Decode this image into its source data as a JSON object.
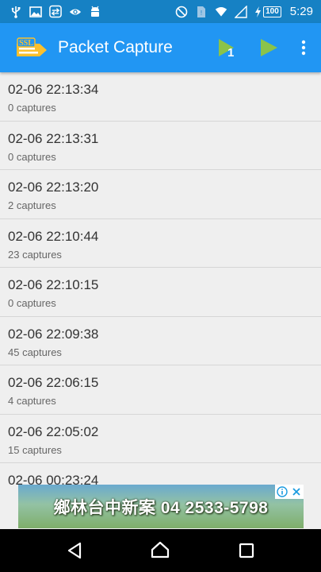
{
  "status_bar": {
    "time": "5:29",
    "battery": "100",
    "icons": [
      "usb-icon",
      "image-icon",
      "vpn-icon",
      "eye-icon",
      "android-icon",
      "do-not-disturb-icon",
      "sim-icon",
      "wifi-icon",
      "signal-icon",
      "battery-charging-icon"
    ]
  },
  "app_bar": {
    "title": "Packet Capture",
    "logo_text": "SSL",
    "start_badge": "1",
    "accent": "#2196f3",
    "status_color": "#1681c4",
    "play_color": "#8bc34a"
  },
  "captures": [
    {
      "timestamp": "02-06 22:13:34",
      "count": "0 captures"
    },
    {
      "timestamp": "02-06 22:13:31",
      "count": "0 captures"
    },
    {
      "timestamp": "02-06 22:13:20",
      "count": "2 captures"
    },
    {
      "timestamp": "02-06 22:10:44",
      "count": "23 captures"
    },
    {
      "timestamp": "02-06 22:10:15",
      "count": "0 captures"
    },
    {
      "timestamp": "02-06 22:09:38",
      "count": "45 captures"
    },
    {
      "timestamp": "02-06 22:06:15",
      "count": "4 captures"
    },
    {
      "timestamp": "02-06 22:05:02",
      "count": "15 captures"
    },
    {
      "timestamp": "02-06 00:23:24",
      "count": ""
    }
  ],
  "ad": {
    "text": "鄉林台中新案 04 2533-5798"
  }
}
